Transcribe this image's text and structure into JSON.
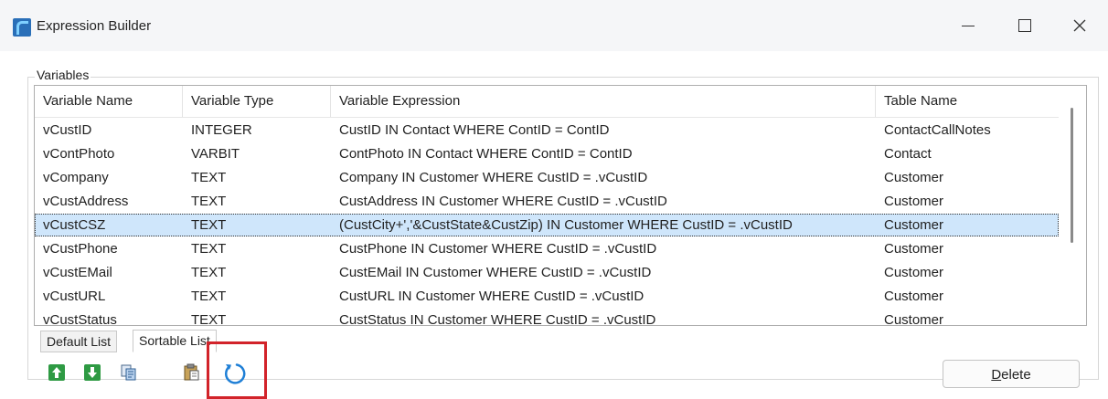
{
  "window": {
    "title": "Expression Builder"
  },
  "variables": {
    "group_label": "Variables",
    "columns": [
      "Variable Name",
      "Variable Type",
      "Variable Expression",
      "Table Name"
    ],
    "rows": [
      {
        "name": "vCustID",
        "type": "INTEGER",
        "expression": "CustID IN Contact WHERE ContID = ContID",
        "table": "ContactCallNotes"
      },
      {
        "name": "vContPhoto",
        "type": "VARBIT",
        "expression": "ContPhoto IN Contact WHERE ContID = ContID",
        "table": "Contact"
      },
      {
        "name": "vCompany",
        "type": "TEXT",
        "expression": "Company IN Customer WHERE CustID = .vCustID",
        "table": "Customer"
      },
      {
        "name": "vCustAddress",
        "type": "TEXT",
        "expression": "CustAddress IN Customer WHERE CustID = .vCustID",
        "table": "Customer"
      },
      {
        "name": "vCustCSZ",
        "type": "TEXT",
        "expression": "(CustCity+','&CustState&CustZip) IN Customer WHERE CustID = .vCustID",
        "table": "Customer"
      },
      {
        "name": "vCustPhone",
        "type": "TEXT",
        "expression": "CustPhone IN Customer WHERE CustID = .vCustID",
        "table": "Customer"
      },
      {
        "name": "vCustEMail",
        "type": "TEXT",
        "expression": "CustEMail IN Customer WHERE CustID = .vCustID",
        "table": "Customer"
      },
      {
        "name": "vCustURL",
        "type": "TEXT",
        "expression": "CustURL IN Customer WHERE CustID = .vCustID",
        "table": "Customer"
      },
      {
        "name": "vCustStatus",
        "type": "TEXT",
        "expression": "CustStatus IN Customer WHERE CustID = .vCustID",
        "table": "Customer"
      }
    ],
    "selected_row_index": 4
  },
  "tabs": [
    "Default List",
    "Sortable List"
  ],
  "toolbar": {
    "icons": [
      "move-up-icon",
      "move-down-icon",
      "copy-icon",
      "paste-icon",
      "refresh-icon"
    ],
    "delete_label_accel": "D",
    "delete_label_rest": "elete"
  },
  "colors": {
    "selection": "#cfe6fb",
    "highlight_box": "#d2232a",
    "arrow_green": "#2e9a43",
    "refresh_blue": "#1f7fd6"
  }
}
